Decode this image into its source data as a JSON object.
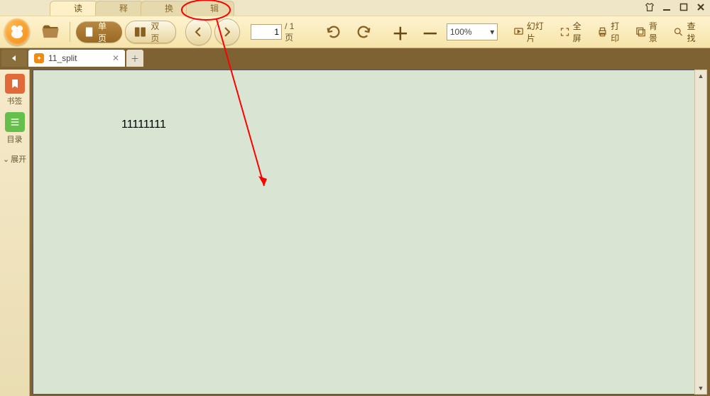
{
  "menu_tabs": {
    "read": "阅读",
    "annotate": "注释",
    "convert": "转换",
    "edit": "编辑"
  },
  "toolbar": {
    "single_page": "单页",
    "double_page": "双页",
    "page_input": "1",
    "page_total": "/ 1页",
    "zoom": "100%",
    "slideshow": "幻灯片",
    "fullscreen": "全屏",
    "print": "打印",
    "background": "背景",
    "find": "查找"
  },
  "file_tab": {
    "name": "11_split"
  },
  "sidebar": {
    "bookmark": "书签",
    "toc": "目录",
    "expand": "展开"
  },
  "document": {
    "body": "11111111"
  }
}
